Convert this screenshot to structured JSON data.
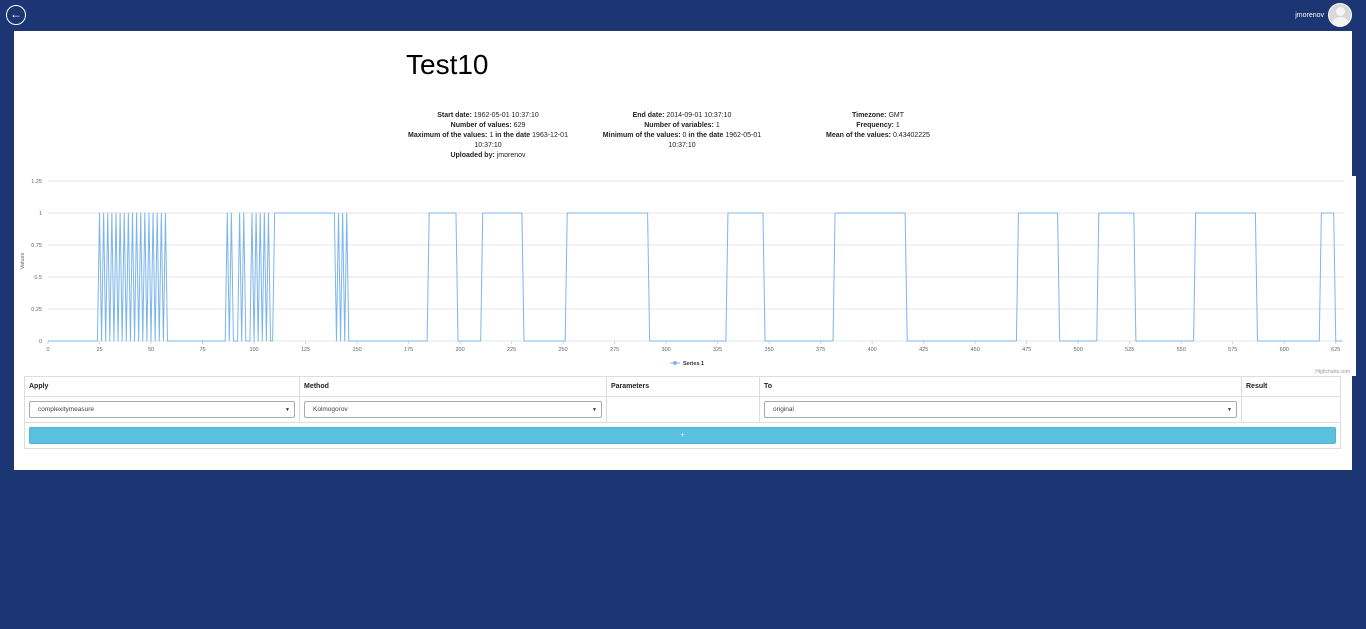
{
  "header": {
    "back_icon": "arrow-left-circle-icon",
    "username": "jmorenov",
    "avatar_icon": "user-avatar-icon"
  },
  "page": {
    "title": "Test10"
  },
  "info": {
    "col1": {
      "start_date_label": "Start date:",
      "start_date": "1962-05-01 10:37:10",
      "num_values_label": "Number of values:",
      "num_values": "629",
      "max_label": "Maximum of the values:",
      "max_value": "1",
      "max_date_label": "in the date",
      "max_date": "1963-12-01 10:37:10",
      "uploaded_label": "Uploaded by:",
      "uploaded_by": "jmorenov"
    },
    "col2": {
      "end_date_label": "End date:",
      "end_date": "2014-09-01 10:37:10",
      "num_vars_label": "Number of variables:",
      "num_vars": "1",
      "min_label": "Minimum of the values:",
      "min_value": "0",
      "min_date_label": "in the date",
      "min_date": "1962-05-01 10:37:10"
    },
    "col3": {
      "timezone_label": "Timezone:",
      "timezone": "GMT",
      "frequency_label": "Frequency:",
      "frequency": "1",
      "mean_label": "Mean of the values:",
      "mean": "0.43402225"
    }
  },
  "chart_data": {
    "type": "line",
    "title": "",
    "xlabel": "",
    "ylabel": "Values",
    "xlim": [
      0,
      629
    ],
    "ylim": [
      0,
      1.25
    ],
    "x_ticks": [
      0,
      25,
      50,
      75,
      100,
      125,
      150,
      175,
      200,
      225,
      250,
      275,
      300,
      325,
      350,
      375,
      400,
      425,
      450,
      475,
      500,
      525,
      550,
      575,
      600,
      625
    ],
    "y_ticks": [
      "0",
      "0.25",
      "0.5",
      "0.75",
      "1",
      "1.25"
    ],
    "grid": true,
    "legend": "bottom-center",
    "series": [
      {
        "name": "Series 1",
        "color": "#7cb5ec",
        "ones_intervals": [
          [
            25,
            25
          ],
          [
            27,
            27
          ],
          [
            29,
            29
          ],
          [
            31,
            31
          ],
          [
            33,
            33
          ],
          [
            35,
            35
          ],
          [
            37,
            37
          ],
          [
            39,
            39
          ],
          [
            41,
            41
          ],
          [
            43,
            43
          ],
          [
            45,
            45
          ],
          [
            47,
            47
          ],
          [
            49,
            49
          ],
          [
            51,
            51
          ],
          [
            53,
            53
          ],
          [
            55,
            55
          ],
          [
            57,
            57
          ],
          [
            87,
            87
          ],
          [
            89,
            89
          ],
          [
            93,
            93
          ],
          [
            95,
            95
          ],
          [
            99,
            99
          ],
          [
            101,
            101
          ],
          [
            103,
            103
          ],
          [
            105,
            105
          ],
          [
            107,
            107
          ],
          [
            110,
            139
          ],
          [
            141,
            141
          ],
          [
            143,
            143
          ],
          [
            145,
            145
          ],
          [
            185,
            198
          ],
          [
            211,
            230
          ],
          [
            252,
            291
          ],
          [
            330,
            347
          ],
          [
            382,
            416
          ],
          [
            471,
            490
          ],
          [
            510,
            527
          ],
          [
            557,
            586
          ],
          [
            618,
            624
          ]
        ]
      }
    ]
  },
  "chart_credit": "Highcharts.com",
  "table": {
    "headers": {
      "apply": "Apply",
      "method": "Method",
      "parameters": "Parameters",
      "to": "To",
      "result": "Result"
    },
    "row": {
      "apply": "complexitymeasure",
      "method": "Kolmogorov",
      "parameters": "",
      "to": "original",
      "result": ""
    },
    "add_label": "+"
  }
}
